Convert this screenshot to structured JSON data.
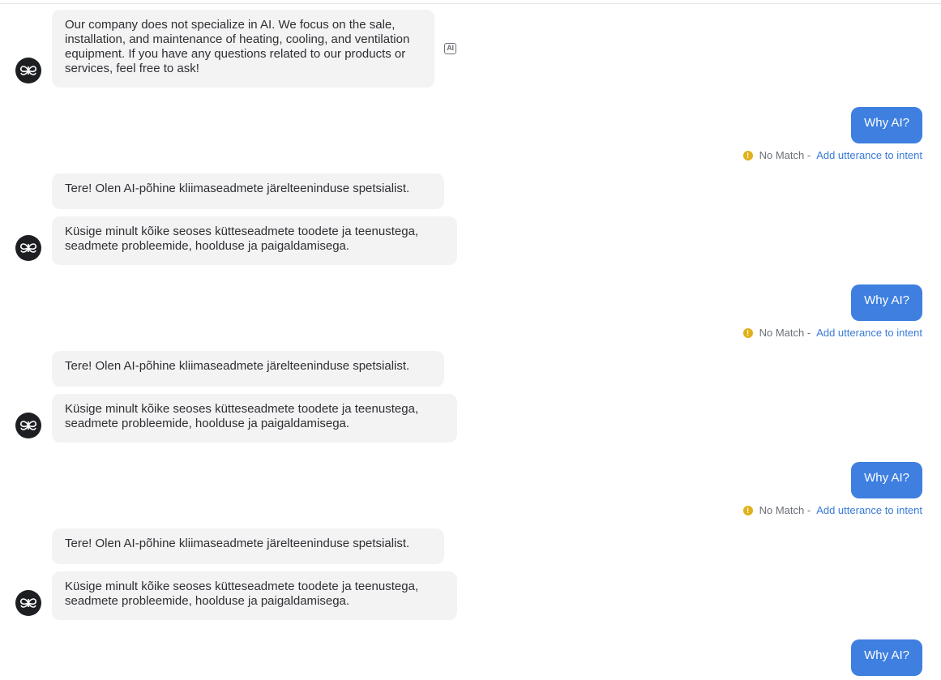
{
  "messages": {
    "bot_intro": "Our company does not specialize in AI. We focus on the sale, installation, and maintenance of heating, cooling, and ventilation equipment. If you have any questions related to our products or services, feel free to ask!",
    "ai_badge": "AI",
    "user_text": "Why AI?",
    "bot_greeting": "Tere! Olen AI-põhine kliimaseadmete järelteeninduse spetsialist.",
    "bot_help": "Küsige minult kõike seoses kütteseadmete toodete ja teenustega, seadmete probleemide, hoolduse ja paigaldamisega."
  },
  "status": {
    "no_match": "No Match -",
    "add_utterance": "Add utterance to intent"
  },
  "icons": {
    "avatar": "bot-avatar-icon",
    "warning": "info-warning-icon"
  },
  "colors": {
    "user_bubble": "#3e7fe0",
    "bot_bubble": "#f3f3f4",
    "link": "#3a7bd5",
    "warning": "#e0b21a"
  }
}
